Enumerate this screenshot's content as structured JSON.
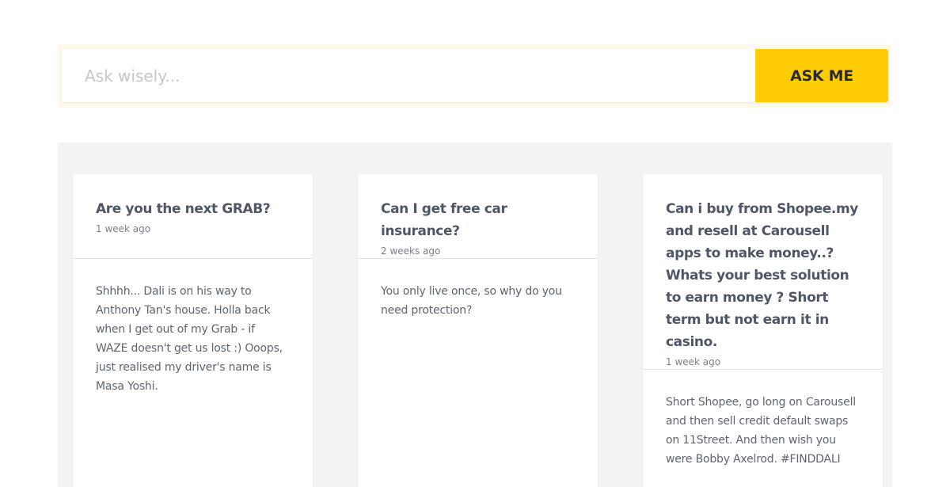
{
  "search": {
    "placeholder": "Ask wisely...",
    "button_label": "ASK ME"
  },
  "colors": {
    "accent": "#ffcc06",
    "background": "#f3f3f3"
  },
  "questions": [
    {
      "title": "Are you the next GRAB?",
      "time": "1 week ago",
      "answer": "Shhhh... Dali is on his way to Anthony Tan's house. Holla back when I get out of my Grab - if WAZE doesn't get us lost :) Ooops, just realised my driver's name is Masa Yoshi."
    },
    {
      "title": "Can I get free car insurance?",
      "time": "2 weeks ago",
      "answer": "You only live once, so why do you need protection?"
    },
    {
      "title": "Can i buy from Shopee.my and resell at Carousell apps to make money..? Whats your best solution to earn money ? Short term but not earn it in casino.",
      "time": "1 week ago",
      "answer": "Short Shopee, go long on Carousell and then sell credit default swaps on 11Street. And then wish you were Bobby Axelrod. #FINDDALI"
    }
  ]
}
